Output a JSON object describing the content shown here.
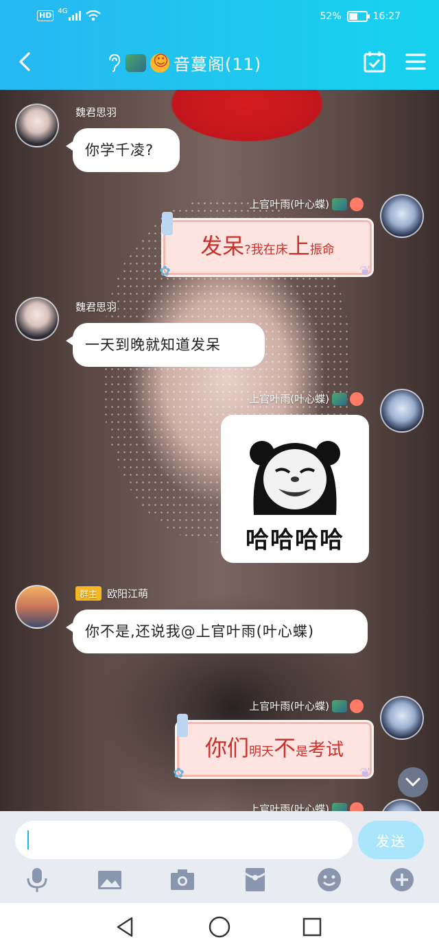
{
  "status_bar": {
    "network": "HD",
    "signal": "4G",
    "battery_percent": "52%",
    "battery_level": 0.52,
    "time": "16:27"
  },
  "header": {
    "title": "音蔓阁(11)",
    "icons": [
      "back-arrow-icon",
      "ear-icon",
      "dragon-emoji-icon",
      "smile-emoji-icon",
      "calendar-check-icon",
      "menu-icon"
    ]
  },
  "messages": [
    {
      "sender": "魏君思羽",
      "side": "left",
      "text": "你学千凌?"
    },
    {
      "sender": "上官叶雨(叶心蝶)",
      "side": "right",
      "fancy": {
        "p1": "发呆",
        "p2": "?我在",
        "p3": "床",
        "p4": "上",
        "p5": "振命"
      }
    },
    {
      "sender": "魏君思羽",
      "side": "left",
      "text": "一天到晚就知道发呆"
    },
    {
      "sender": "上官叶雨(叶心蝶)",
      "side": "right",
      "sticker_text": "哈哈哈哈"
    },
    {
      "sender": "欧阳江萌",
      "badge": "群主",
      "side": "left",
      "text": "你不是,还说我@上官叶雨(叶心蝶)"
    },
    {
      "sender": "上官叶雨(叶心蝶)",
      "side": "right",
      "fancy": {
        "p1": "你们",
        "p2": "明天",
        "p3": "不",
        "p4": "是",
        "p5": "考试"
      }
    },
    {
      "sender": "上官叶雨(叶心蝶)",
      "side": "right"
    }
  ],
  "input": {
    "value": "",
    "send_label": "发送"
  },
  "toolbar": [
    "microphone-icon",
    "image-icon",
    "camera-icon",
    "red-packet-icon",
    "emoji-icon",
    "plus-icon"
  ],
  "colors": {
    "header_start": "#27b7f2",
    "header_end": "#16d2ee",
    "send_button": "#a9e6fb",
    "accent": "#16b4f0"
  }
}
